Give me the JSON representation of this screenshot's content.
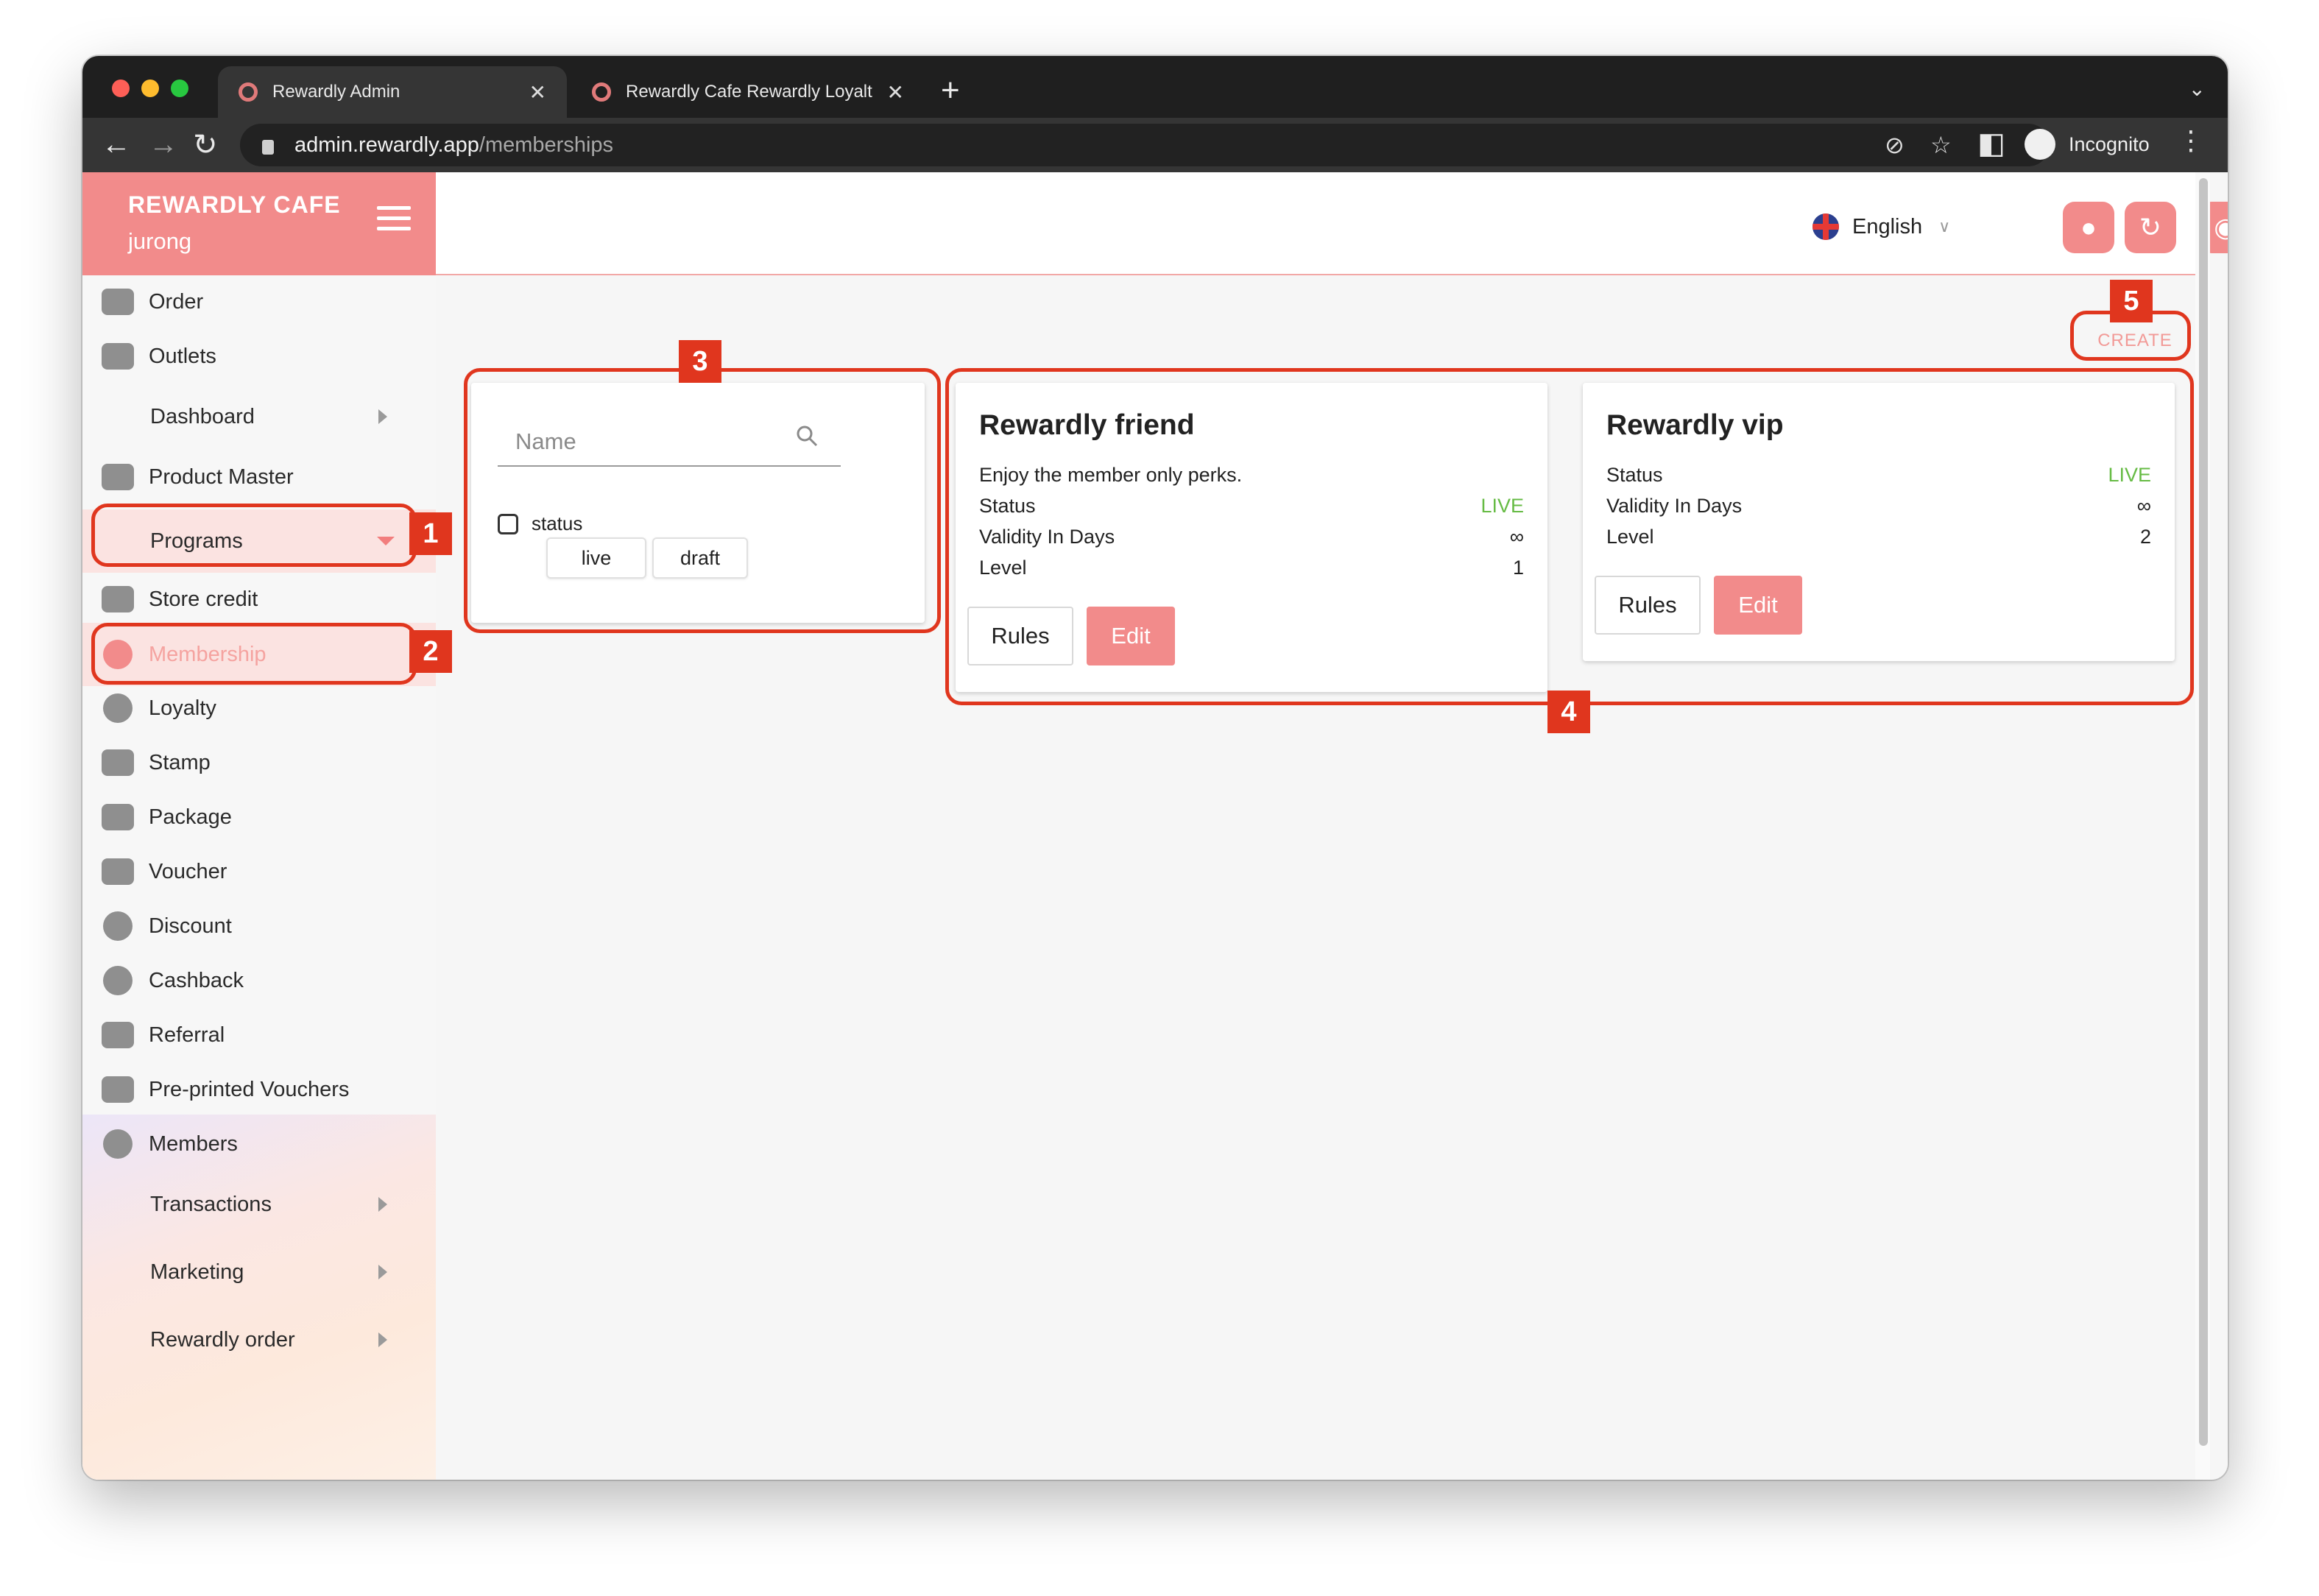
{
  "browser": {
    "tabs": [
      {
        "title": "Rewardly Admin"
      },
      {
        "title": "Rewardly Cafe Rewardly Loyalt"
      }
    ],
    "address": {
      "host": "admin.rewardly.app",
      "path": "/memberships"
    },
    "profile": "Incognito"
  },
  "brand": {
    "name": "REWARDLY CAFE",
    "outlet": "jurong"
  },
  "sidebar": {
    "items": [
      {
        "label": "Order"
      },
      {
        "label": "Outlets"
      },
      {
        "label": "Dashboard"
      },
      {
        "label": "Product Master"
      },
      {
        "label": "Programs"
      },
      {
        "label": "Store credit"
      },
      {
        "label": "Membership"
      },
      {
        "label": "Loyalty"
      },
      {
        "label": "Stamp"
      },
      {
        "label": "Package"
      },
      {
        "label": "Voucher"
      },
      {
        "label": "Discount"
      },
      {
        "label": "Cashback"
      },
      {
        "label": "Referral"
      },
      {
        "label": "Pre-printed Vouchers"
      },
      {
        "label": "Members"
      },
      {
        "label": "Transactions"
      },
      {
        "label": "Marketing"
      },
      {
        "label": "Rewardly order"
      }
    ]
  },
  "header": {
    "language": "English"
  },
  "actions": {
    "create_label": "CREATE"
  },
  "filter": {
    "search_placeholder": "Name",
    "status_label": "status",
    "chips": [
      "live",
      "draft"
    ]
  },
  "memberships": [
    {
      "title": "Rewardly friend",
      "description": "Enjoy the member only perks.",
      "status_label": "Status",
      "status": "LIVE",
      "validity_label": "Validity In Days",
      "validity": "∞",
      "level_label": "Level",
      "level": "1",
      "rules_label": "Rules",
      "edit_label": "Edit"
    },
    {
      "title": "Rewardly vip",
      "status_label": "Status",
      "status": "LIVE",
      "validity_label": "Validity In Days",
      "validity": "∞",
      "level_label": "Level",
      "level": "2",
      "rules_label": "Rules",
      "edit_label": "Edit"
    }
  ],
  "annotations": [
    "1",
    "2",
    "3",
    "4",
    "5"
  ],
  "colors": {
    "accent": "#f28b8b",
    "live": "#66bb44",
    "annotation": "#e0361e"
  }
}
